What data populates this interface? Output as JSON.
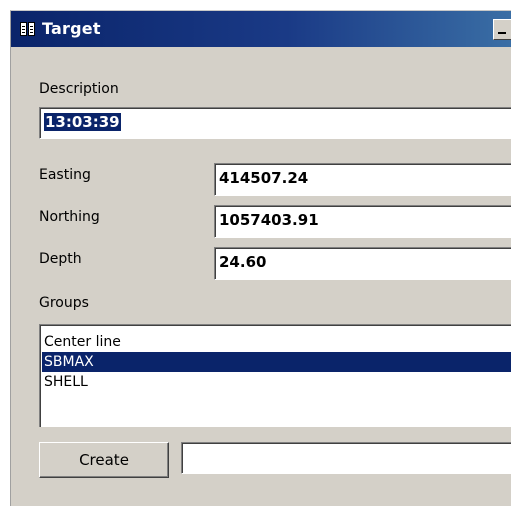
{
  "window": {
    "title": "Target"
  },
  "form": {
    "description_label": "Description",
    "description_value": "13:03:39",
    "easting_label": "Easting",
    "easting_value": "414507.24",
    "northing_label": "Northing",
    "northing_value": "1057403.91",
    "depth_label": "Depth",
    "depth_value": "24.60",
    "groups_label": "Groups"
  },
  "groups": {
    "items": [
      {
        "label": "Center line",
        "selected": false
      },
      {
        "label": "SBMAX",
        "selected": true
      },
      {
        "label": "SHELL",
        "selected": false
      }
    ]
  },
  "create": {
    "button_label": "Create",
    "input_value": ""
  },
  "colors": {
    "titlebar": "#0a246a",
    "window_background": "#d4d0c8",
    "selection": "#0a246a"
  },
  "icons": {
    "app": "book-icon",
    "minimize": "minimize-icon"
  }
}
